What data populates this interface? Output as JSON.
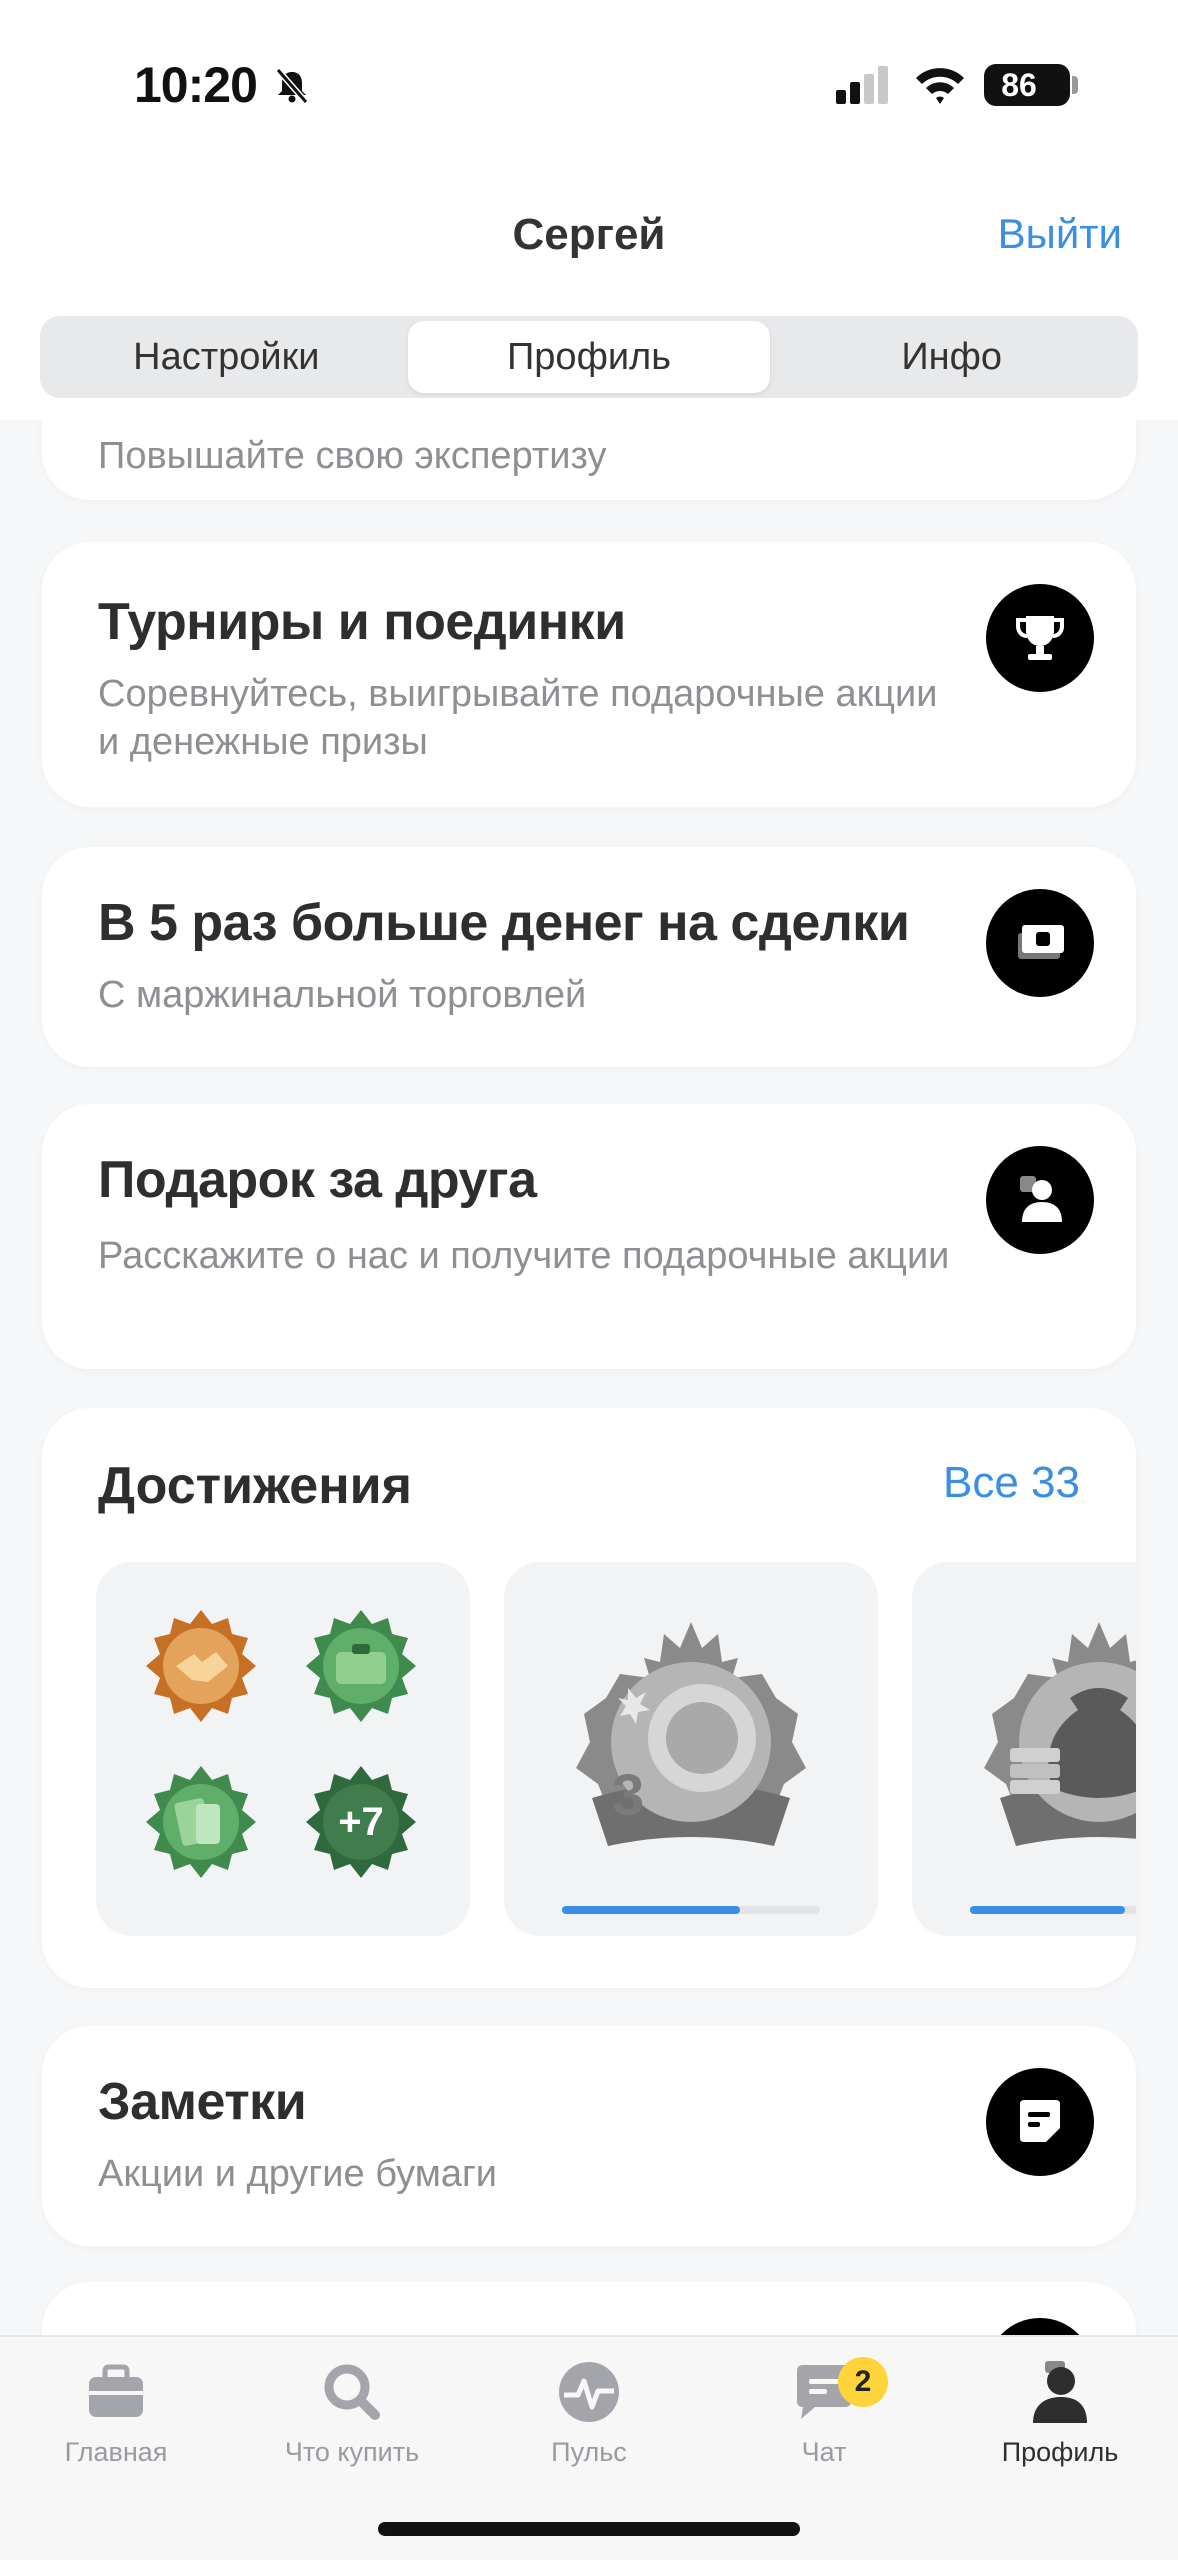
{
  "status_bar": {
    "time": "10:20",
    "battery": "86"
  },
  "header": {
    "title": "Сергей",
    "logout": "Выйти",
    "tabs": [
      {
        "label": "Настройки",
        "active": false
      },
      {
        "label": "Профиль",
        "active": true
      },
      {
        "label": "Инфо",
        "active": false
      }
    ]
  },
  "cards": {
    "expertise": {
      "subtitle": "Повышайте свою экспертизу"
    },
    "tournaments": {
      "title": "Турниры и поединки",
      "subtitle": "Соревнуйтесь, выигрывайте подарочные акции и денежные призы",
      "icon": "trophy-icon"
    },
    "margin": {
      "title": "В 5 раз больше денег на сделки",
      "subtitle": "С маржинальной торговлей",
      "icon": "money-icon"
    },
    "referral": {
      "title": "Подарок за друга",
      "subtitle": "Расскажите о нас и получите подарочные акции",
      "icon": "friend-icon"
    },
    "notes": {
      "title": "Заметки",
      "subtitle": "Акции и другие бумаги",
      "icon": "notes-icon"
    }
  },
  "achievements": {
    "title": "Достижения",
    "all_label": "Все 33",
    "extra_count": "+7",
    "badge_number": "3",
    "progress": [
      0.69,
      0.6
    ],
    "colors": {
      "bronze": "#d88a3a",
      "green": "#4f9a5a",
      "dark_green": "#2f6a3e",
      "silver": "#8f8f8f"
    }
  },
  "tab_bar": {
    "items": [
      {
        "label": "Главная",
        "icon": "briefcase-icon"
      },
      {
        "label": "Что купить",
        "icon": "search-icon"
      },
      {
        "label": "Пульс",
        "icon": "pulse-icon"
      },
      {
        "label": "Чат",
        "icon": "chat-icon",
        "badge": "2"
      },
      {
        "label": "Профиль",
        "icon": "profile-icon",
        "active": true
      }
    ]
  },
  "colors": {
    "accent": "#3a8ee6",
    "badge": "#ffd43b"
  }
}
